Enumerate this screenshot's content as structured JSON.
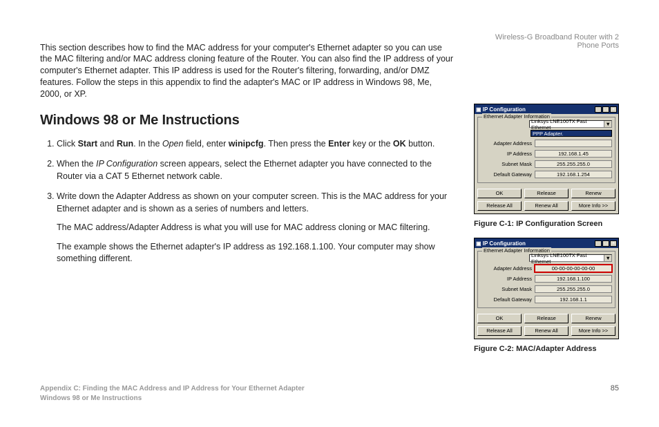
{
  "header": {
    "product": "Wireless-G Broadband Router with 2 Phone Ports"
  },
  "intro": "This section describes how to find the MAC address for your computer's Ethernet adapter so you can use the MAC filtering and/or MAC address cloning feature of the Router. You can also find the IP address of your computer's Ethernet adapter. This IP address is used for the Router's filtering, forwarding, and/or DMZ features. Follow the steps in this appendix to find the adapter's MAC or IP address in Windows 98, Me, 2000, or XP.",
  "heading": "Windows 98 or Me Instructions",
  "steps": {
    "s1": {
      "t1": "Click ",
      "b1": "Start",
      "t2": " and ",
      "b2": "Run",
      "t3": ". In the ",
      "i1": "Open",
      "t4": " field, enter ",
      "b3": "winipcfg",
      "t5": ". Then press the ",
      "b4": "Enter",
      "t6": " key or the ",
      "b5": "OK",
      "t7": " button."
    },
    "s2": {
      "t1": "When the ",
      "i1": "IP Configuration",
      "t2": " screen appears, select the Ethernet adapter you have connected to the Router via a CAT 5 Ethernet network cable."
    },
    "s3": {
      "t1": "Write down the Adapter Address as shown on your computer screen. This is the MAC address for your Ethernet adapter and is shown as a series of numbers and letters.",
      "p2": "The MAC address/Adapter Address is what you will use for MAC address cloning or MAC filtering.",
      "p3": "The example shows the Ethernet adapter's IP address as 192.168.1.100. Your computer may show something different."
    }
  },
  "figures": {
    "f1": {
      "caption": "Figure C-1: IP Configuration Screen",
      "win": {
        "title": "IP Configuration",
        "group": "Ethernet Adapter Information",
        "combo": "Linksys LNE100TX Fast Ethernet",
        "selected": "PPP Adapter.",
        "rows": [
          {
            "label": "Adapter Address",
            "value": ""
          },
          {
            "label": "IP Address",
            "value": "192.168.1.45"
          },
          {
            "label": "Subnet Mask",
            "value": "255.255.255.0"
          },
          {
            "label": "Default Gateway",
            "value": "192.168.1.254"
          }
        ],
        "buttons_top": [
          "OK",
          "Release",
          "Renew"
        ],
        "buttons_bottom": [
          "Release All",
          "Renew All",
          "More Info >>"
        ]
      }
    },
    "f2": {
      "caption": "Figure C-2: MAC/Adapter Address",
      "win": {
        "title": "IP Configuration",
        "group": "Ethernet Adapter Information",
        "combo": "Linksys LNE100TX Fast Ethernet",
        "rows": [
          {
            "label": "Adapter Address",
            "value": "00-00-00-00-00-00",
            "highlight": true
          },
          {
            "label": "IP Address",
            "value": "192.168.1.100"
          },
          {
            "label": "Subnet Mask",
            "value": "255.255.255.0"
          },
          {
            "label": "Default Gateway",
            "value": "192.168.1.1"
          }
        ],
        "buttons_top": [
          "OK",
          "Release",
          "Renew"
        ],
        "buttons_bottom": [
          "Release All",
          "Renew All",
          "More Info >>"
        ]
      }
    }
  },
  "footer": {
    "appendix": "Appendix C: Finding the MAC Address and IP Address for Your Ethernet Adapter",
    "subtitle": "Windows 98 or Me Instructions",
    "page": "85"
  }
}
